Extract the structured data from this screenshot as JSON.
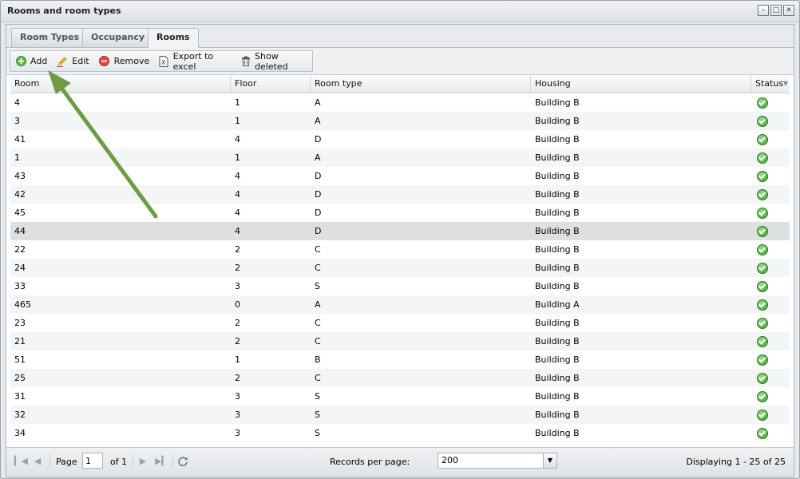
{
  "window": {
    "title": "Rooms and room types"
  },
  "tabs": [
    {
      "label": "Room Types"
    },
    {
      "label": "Occupancy"
    },
    {
      "label": "Rooms"
    }
  ],
  "toolbar": {
    "add_label": "Add",
    "edit_label": "Edit",
    "remove_label": "Remove",
    "export_label": "Export to excel",
    "show_deleted_label": "Show deleted"
  },
  "columns": {
    "room": "Room",
    "floor": "Floor",
    "room_type": "Room type",
    "housing": "Housing",
    "status": "Status"
  },
  "rows": [
    {
      "room": "4",
      "floor": "1",
      "type": "A",
      "housing": "Building B",
      "status": "ok"
    },
    {
      "room": "3",
      "floor": "1",
      "type": "A",
      "housing": "Building B",
      "status": "ok"
    },
    {
      "room": "41",
      "floor": "4",
      "type": "D",
      "housing": "Building B",
      "status": "ok"
    },
    {
      "room": "1",
      "floor": "1",
      "type": "A",
      "housing": "Building B",
      "status": "ok"
    },
    {
      "room": "43",
      "floor": "4",
      "type": "D",
      "housing": "Building B",
      "status": "ok"
    },
    {
      "room": "42",
      "floor": "4",
      "type": "D",
      "housing": "Building B",
      "status": "ok"
    },
    {
      "room": "45",
      "floor": "4",
      "type": "D",
      "housing": "Building B",
      "status": "ok"
    },
    {
      "room": "44",
      "floor": "4",
      "type": "D",
      "housing": "Building B",
      "status": "ok"
    },
    {
      "room": "22",
      "floor": "2",
      "type": "C",
      "housing": "Building B",
      "status": "ok"
    },
    {
      "room": "24",
      "floor": "2",
      "type": "C",
      "housing": "Building B",
      "status": "ok"
    },
    {
      "room": "33",
      "floor": "3",
      "type": "S",
      "housing": "Building B",
      "status": "ok"
    },
    {
      "room": "465",
      "floor": "0",
      "type": "A",
      "housing": "Building A",
      "status": "ok"
    },
    {
      "room": "23",
      "floor": "2",
      "type": "C",
      "housing": "Building B",
      "status": "ok"
    },
    {
      "room": "21",
      "floor": "2",
      "type": "C",
      "housing": "Building B",
      "status": "ok"
    },
    {
      "room": "51",
      "floor": "1",
      "type": "B",
      "housing": "Building B",
      "status": "ok"
    },
    {
      "room": "25",
      "floor": "2",
      "type": "C",
      "housing": "Building B",
      "status": "ok"
    },
    {
      "room": "31",
      "floor": "3",
      "type": "S",
      "housing": "Building B",
      "status": "ok"
    },
    {
      "room": "32",
      "floor": "3",
      "type": "S",
      "housing": "Building B",
      "status": "ok"
    },
    {
      "room": "34",
      "floor": "3",
      "type": "S",
      "housing": "Building B",
      "status": "ok"
    }
  ],
  "selected_row": 7,
  "pager": {
    "page_label": "Page",
    "page_value": "1",
    "of_label": "of 1",
    "records_label": "Records per page:",
    "records_value": "200",
    "display_text": "Displaying 1 - 25 of 25"
  },
  "colors": {
    "status_ok": "#3a9a2a",
    "annotation_arrow": "#6e9c45",
    "selected_row": "#dedfe0"
  }
}
